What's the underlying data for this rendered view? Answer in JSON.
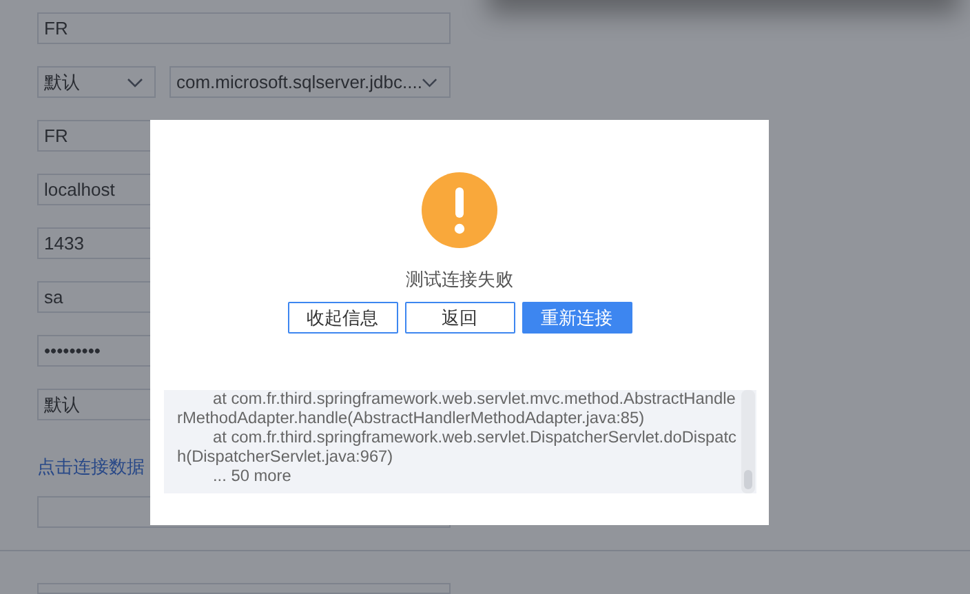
{
  "form": {
    "fields": [
      {
        "kind": "text",
        "value": "FR"
      },
      {
        "kind": "select-pair",
        "value": "默认",
        "value2": "com.microsoft.sqlserver.jdbc...."
      },
      {
        "kind": "text",
        "value": "FR"
      },
      {
        "kind": "text",
        "value": "localhost"
      },
      {
        "kind": "text",
        "value": "1433"
      },
      {
        "kind": "text",
        "value": "sa"
      },
      {
        "kind": "password",
        "value": "•••••••••"
      },
      {
        "kind": "text",
        "value": "默认"
      },
      {
        "kind": "link",
        "value": "点击连接数据"
      },
      {
        "kind": "empty"
      }
    ]
  },
  "dialog": {
    "message": "测试连接失败",
    "buttons": [
      {
        "label": "收起信息",
        "primary": false
      },
      {
        "label": "返回",
        "primary": false
      },
      {
        "label": "重新连接",
        "primary": true
      }
    ],
    "log_lines": [
      "at com.fr.third.springframework.web.servlet.mvc.method.AbstractHandlerMethodAdapter.handle(AbstractHandlerMethodAdapter.java:85)",
      "at com.fr.third.springframework.web.servlet.DispatcherServlet.doDispatch(DispatcherServlet.java:967)",
      "... 50 more"
    ]
  }
}
